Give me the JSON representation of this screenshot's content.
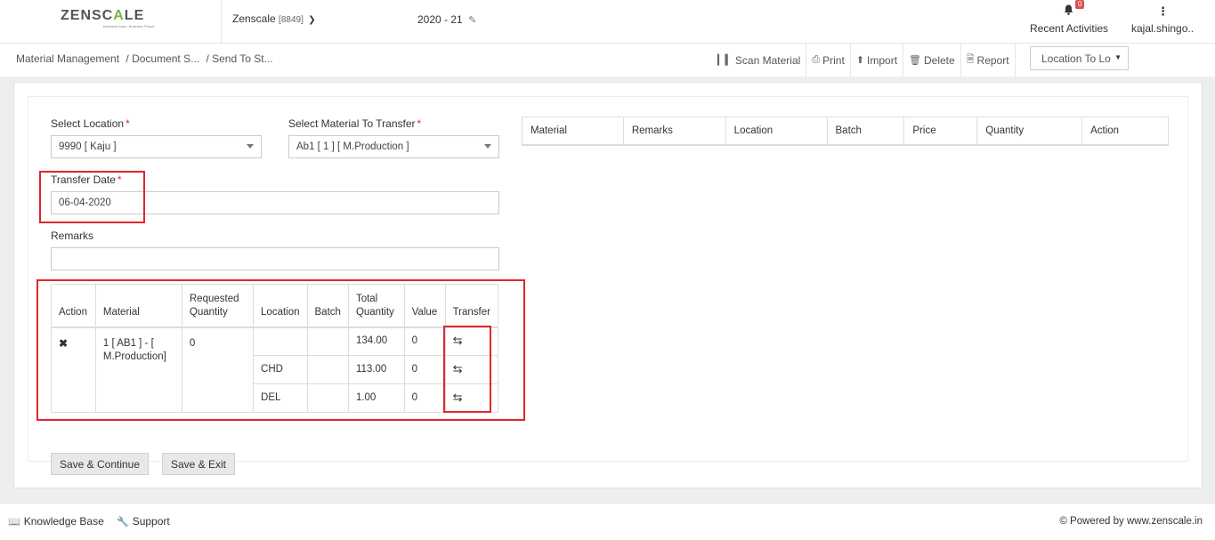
{
  "header": {
    "logo_text_1": "ZENSC",
    "logo_text_accent": "A",
    "logo_text_2": "LE",
    "logo_tagline": "Business Ease. Business Peace.",
    "company_name": "Zenscale",
    "company_code": "[8849]",
    "financial_year": "2020 - 21",
    "notifications_count": "0",
    "recent_activities_label": "Recent Activities",
    "user_name": "kajal.shingo.."
  },
  "breadcrumb": {
    "items": [
      "Material Management",
      "/ Document S...",
      "/ Send To St..."
    ]
  },
  "toolbar": {
    "scan_label": "Scan Material",
    "print_label": "Print",
    "import_label": "Import",
    "delete_label": "Delete",
    "report_label": "Report",
    "location_select_value": "Location To Lo"
  },
  "form": {
    "select_location_label": "Select Location",
    "select_location_value": "9990 [ Kaju ]",
    "select_material_label": "Select Material To Transfer",
    "select_material_value": "Ab1 [ 1 ] [ M.Production ]",
    "transfer_date_label": "Transfer Date",
    "transfer_date_value": "06-04-2020",
    "remarks_label": "Remarks",
    "remarks_value": "",
    "required_mark": "*"
  },
  "transfer_table": {
    "headers": {
      "action": "Action",
      "material": "Material",
      "requested_quantity": "Requested Quantity",
      "location": "Location",
      "batch": "Batch",
      "total_quantity": "Total Quantity",
      "value": "Value",
      "transfer": "Transfer"
    },
    "material": "1 [ AB1 ] - [ M.Production]",
    "requested_quantity": "0",
    "rows": [
      {
        "location": "",
        "batch": "",
        "total_quantity": "134.00",
        "value": "0"
      },
      {
        "location": "CHD",
        "batch": "",
        "total_quantity": "113.00",
        "value": "0"
      },
      {
        "location": "DEL",
        "batch": "",
        "total_quantity": "1.00",
        "value": "0"
      }
    ]
  },
  "summary_table": {
    "headers": [
      "Material",
      "Remarks",
      "Location",
      "Batch",
      "Price",
      "Quantity",
      "Action"
    ]
  },
  "buttons": {
    "save_continue": "Save & Continue",
    "save_exit": "Save & Exit"
  },
  "footer": {
    "knowledge_base": "Knowledge Base",
    "support": "Support",
    "powered_by": "© Powered by www.zenscale.in"
  },
  "colors": {
    "required": "#e0262c",
    "highlight_box": "#e0262c",
    "badge": "#d9534f",
    "logo_accent": "#7cb442"
  }
}
